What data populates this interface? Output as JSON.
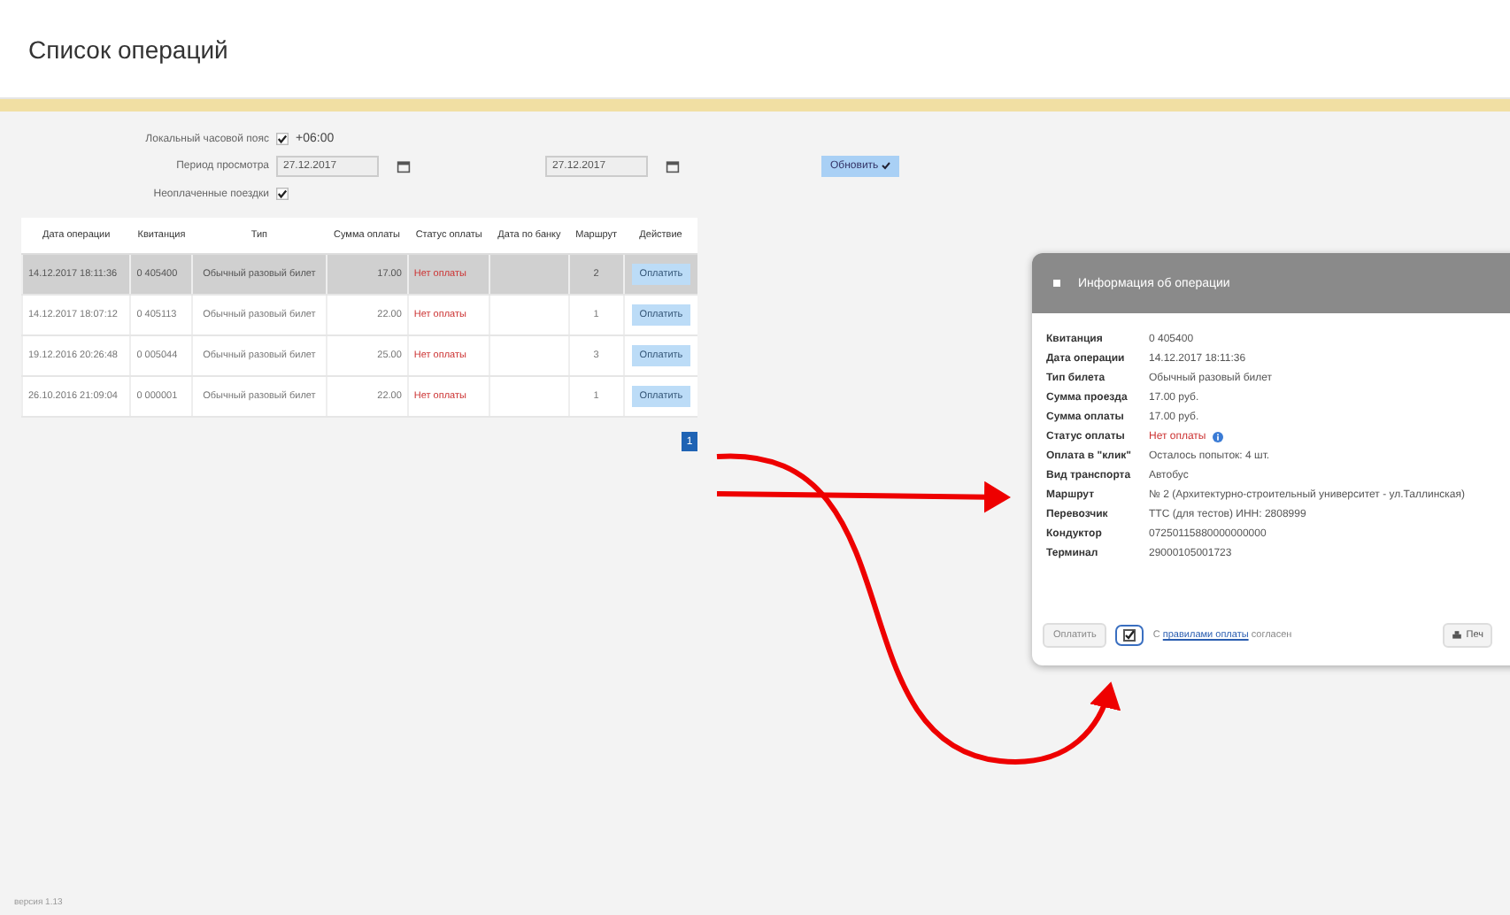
{
  "page": {
    "title": "Список операций",
    "version": "версия 1.13"
  },
  "filters": {
    "timezone_label": "Локальный часовой пояс",
    "timezone_checked": true,
    "timezone_value": "+06:00",
    "period_label": "Период просмотра",
    "date_from": "27.12.2017",
    "date_to": "27.12.2017",
    "refresh_button": "Обновить",
    "unpaid_label": "Неоплаченные поездки",
    "unpaid_checked": true
  },
  "table": {
    "columns": [
      "Дата операции",
      "Квитанция",
      "Тип",
      "Сумма оплаты",
      "Статус оплаты",
      "Дата по банку",
      "Маршрут",
      "Действие"
    ],
    "rows": [
      {
        "date": "14.12.2017 18:11:36",
        "receipt": "0 405400",
        "type": "Обычный разовый билет",
        "amount": "17.00",
        "status": "Нет оплаты",
        "route": "2",
        "action": "Оплатить",
        "selected": true
      },
      {
        "date": "14.12.2017 18:07:12",
        "receipt": "0 405113",
        "type": "Обычный разовый билет",
        "amount": "22.00",
        "status": "Нет оплаты",
        "route": "1",
        "action": "Оплатить",
        "selected": false
      },
      {
        "date": "19.12.2016 20:26:48",
        "receipt": "0 005044",
        "type": "Обычный разовый билет",
        "amount": "25.00",
        "status": "Нет оплаты",
        "route": "3",
        "action": "Оплатить",
        "selected": false
      },
      {
        "date": "26.10.2016 21:09:04",
        "receipt": "0 000001",
        "type": "Обычный разовый билет",
        "amount": "22.00",
        "status": "Нет оплаты",
        "route": "1",
        "action": "Оплатить",
        "selected": false
      }
    ]
  },
  "pagination": [
    {
      "label": "1",
      "selected": true
    }
  ],
  "dialog": {
    "title": "Информация об операции",
    "fields": [
      {
        "label": "Квитанция",
        "value": "0 405400",
        "kind": "text"
      },
      {
        "label": "Дата операции",
        "value": "14.12.2017 18:11:36",
        "kind": "text"
      },
      {
        "label": "Тип билета",
        "value": "Обычный разовый билет",
        "kind": "text"
      },
      {
        "label": "Сумма проезда",
        "value": "17.00 руб.",
        "kind": "text"
      },
      {
        "label": "Сумма оплаты",
        "value": "17.00 руб.",
        "kind": "text"
      },
      {
        "label": "Статус оплаты",
        "value": "Нет оплаты",
        "kind": "status"
      },
      {
        "label": "Оплата в \"клик\"",
        "value": "Осталось попыток: 4 шт.",
        "kind": "text"
      },
      {
        "label": "Вид транспорта",
        "value": "Автобус",
        "kind": "text"
      },
      {
        "label": "Маршрут",
        "value": "№ 2 (Архитектурно-строительный университет - ул.Таллинская)",
        "kind": "text"
      },
      {
        "label": "Перевозчик",
        "value": "ТТС (для тестов) ИНН: 2808999",
        "kind": "text"
      },
      {
        "label": "Кондуктор",
        "value": "07250115880000000000",
        "kind": "text"
      },
      {
        "label": "Терминал",
        "value": "29000105001723",
        "kind": "text"
      }
    ],
    "pay_button": "Оплатить",
    "agree_checked": true,
    "agree_prefix": "С",
    "agree_link": "правилами оплаты",
    "agree_suffix": "согласен",
    "print_button": "Печ"
  }
}
